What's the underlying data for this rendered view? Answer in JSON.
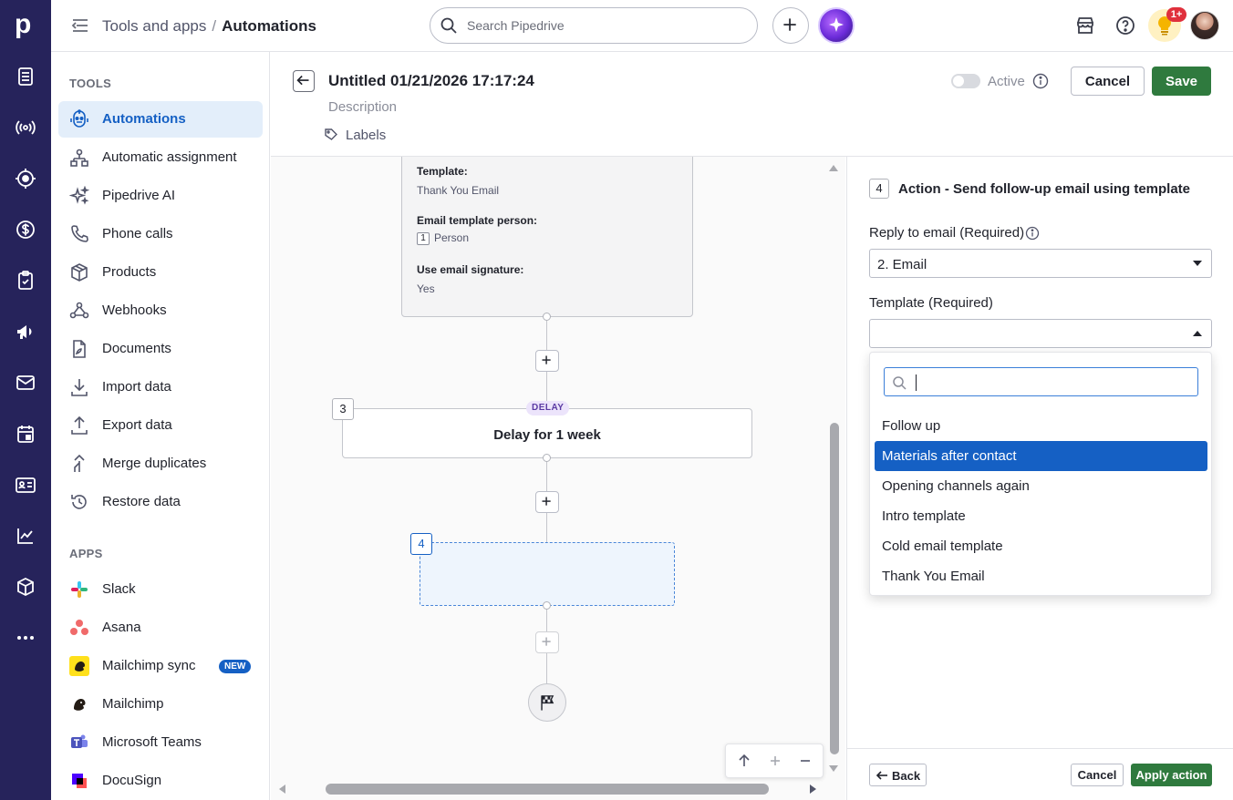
{
  "brand": {
    "logo_letter": "p"
  },
  "rail": {
    "items": [
      "deals-icon",
      "leads-icon",
      "radar-icon",
      "dollar-icon",
      "activities-icon",
      "campaigns-icon",
      "mail-icon",
      "calendar-icon",
      "contacts-icon",
      "insights-icon",
      "products-box-icon",
      "more-icon"
    ]
  },
  "topbar": {
    "breadcrumb_parent": "Tools and apps",
    "breadcrumb_separator": "/",
    "breadcrumb_current": "Automations",
    "search_placeholder": "Search Pipedrive",
    "notification_badge": "1+"
  },
  "sidebar": {
    "tools_title": "TOOLS",
    "tools": [
      {
        "label": "Automations",
        "icon": "robot-icon",
        "active": true
      },
      {
        "label": "Automatic assignment",
        "icon": "assignment-icon"
      },
      {
        "label": "Pipedrive AI",
        "icon": "sparkle-icon"
      },
      {
        "label": "Phone calls",
        "icon": "phone-icon"
      },
      {
        "label": "Products",
        "icon": "box-icon"
      },
      {
        "label": "Webhooks",
        "icon": "webhook-icon"
      },
      {
        "label": "Documents",
        "icon": "document-icon"
      },
      {
        "label": "Import data",
        "icon": "download-icon"
      },
      {
        "label": "Export data",
        "icon": "upload-icon"
      },
      {
        "label": "Merge duplicates",
        "icon": "merge-icon"
      },
      {
        "label": "Restore data",
        "icon": "restore-icon"
      }
    ],
    "apps_title": "APPS",
    "apps": [
      {
        "label": "Slack",
        "icon": "slack-icon"
      },
      {
        "label": "Asana",
        "icon": "asana-icon"
      },
      {
        "label": "Mailchimp sync",
        "icon": "mailchimp-icon",
        "badge": "NEW"
      },
      {
        "label": "Mailchimp",
        "icon": "mailchimp-icon"
      },
      {
        "label": "Microsoft Teams",
        "icon": "teams-icon"
      },
      {
        "label": "DocuSign",
        "icon": "docusign-icon"
      }
    ]
  },
  "editor": {
    "title": "Untitled 01/21/2026 17:17:24",
    "description_placeholder": "Description",
    "labels_text": "Labels",
    "active_label": "Active",
    "cancel_label": "Cancel",
    "save_label": "Save"
  },
  "canvas": {
    "prev_card": {
      "template_key": "Template:",
      "template_value": "Thank You Email",
      "person_key": "Email template person:",
      "person_num": "1",
      "person_value": "Person",
      "signature_key": "Use email signature:",
      "signature_value": "Yes"
    },
    "delay_step_number": "3",
    "delay_tag": "DELAY",
    "delay_title": "Delay for 1 week",
    "new_step_number": "4"
  },
  "panel": {
    "step_number": "4",
    "title": "Action - Send follow-up email using template",
    "reply_label": "Reply to email (Required)",
    "reply_value": "2. Email",
    "template_label": "Template (Required)",
    "template_value": "",
    "options": [
      "Follow up",
      "Materials after contact",
      "Opening channels again",
      "Intro template",
      "Cold email template",
      "Thank You Email"
    ],
    "highlighted_option": "Materials after contact",
    "back_label": "Back",
    "cancel_label": "Cancel",
    "apply_label": "Apply action"
  },
  "colors": {
    "rail": "#26235b",
    "accent_blue": "#1560c4",
    "save_green": "#2f7a3e"
  }
}
